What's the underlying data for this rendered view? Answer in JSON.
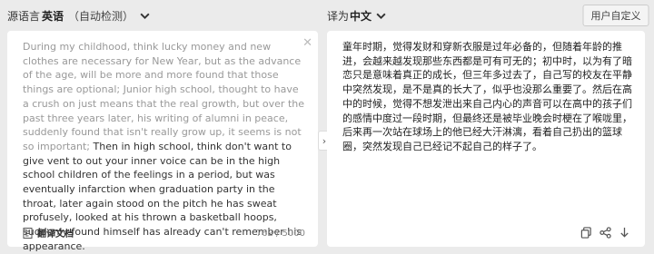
{
  "source": {
    "prefix": "源语言",
    "language": "英语",
    "detect": "（自动检测）",
    "text_muted": "During my childhood, think lucky money and new clothes are necessary for New Year, but as the advance of the age, will be more and more found that those things are optional; Junior high school, thought to have a crush on just means that the real growth, but over the past three years later, his writing of alumni in peace, suddenly found that isn't really grow up, it seems is not so important;",
    "text_main": " Then in high school, think don't want to give vent to out your inner voice can be in the high school children of the feelings in a period, but was eventually infarction when graduation party in the throat, later again stood on the pitch he has sweat profusely, looked at his thrown a basketball hoops, suddenly found himself has already can't remember his appearance.",
    "doc_label": "翻译文档",
    "counter": "762 / 5000"
  },
  "target": {
    "prefix": "译为",
    "language": "中文",
    "text": "童年时期，觉得发财和穿新衣服是过年必备的，但随着年龄的推进，会越来越发现那些东西都是可有可无的；初中时，以为有了暗恋只是意味着真正的成长，但三年多过去了，自己写的校友在平静中突然发现，是不是真的长大了，似乎也没那么重要了。然后在高中的时候，觉得不想发泄出来自己内心的声音可以在高中的孩子们的感情中度过一段时期，但最终还是被毕业晚会时梗在了喉咙里，后来再一次站在球场上的他已经大汗淋漓，看着自己扔出的篮球圈，突然发现自己已经记不起自己的样子了。"
  },
  "custom_button": "用户自定义",
  "icons": [
    "chevron-down-icon",
    "close-icon",
    "document-icon",
    "chevron-right-icon",
    "copy-icon",
    "share-icon",
    "download-icon"
  ]
}
